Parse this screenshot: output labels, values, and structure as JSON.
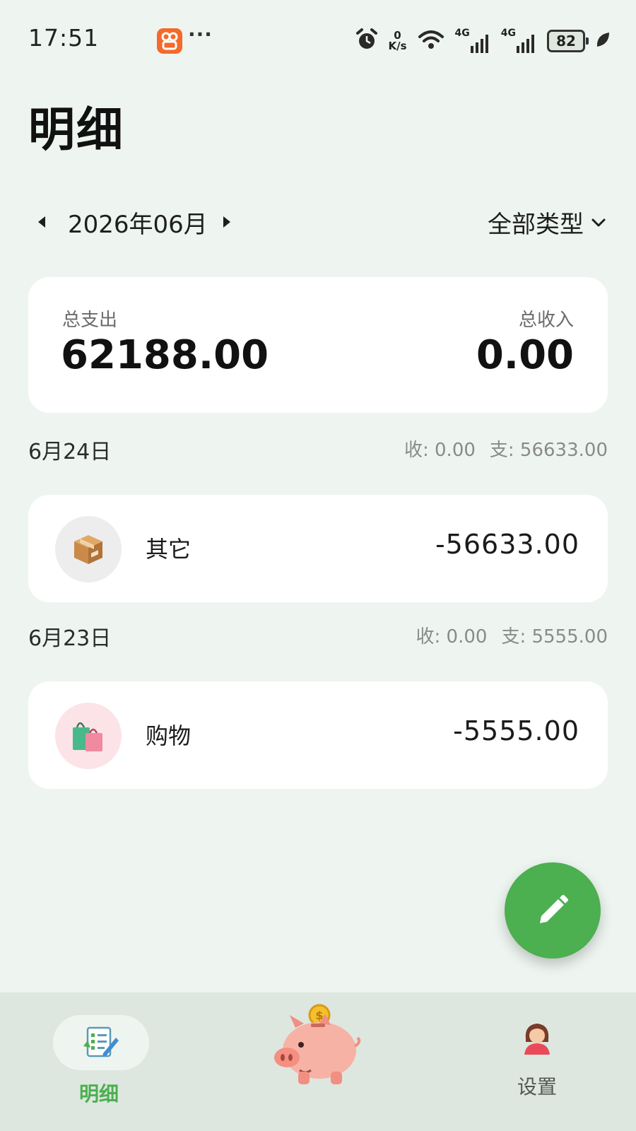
{
  "status_bar": {
    "time": "17:51",
    "dots": "···",
    "speed_value": "0",
    "speed_unit": "K/s",
    "net1": "4G",
    "net2": "4G",
    "battery": "82"
  },
  "header": {
    "title": "明细"
  },
  "filter": {
    "month": "2026年06月",
    "type": "全部类型"
  },
  "summary": {
    "expense_label": "总支出",
    "expense_value": "62188.00",
    "income_label": "总收入",
    "income_value": "0.00"
  },
  "days": [
    {
      "date": "6月24日",
      "income": "收: 0.00",
      "expense": "支: 56633.00",
      "items": [
        {
          "icon": "package-icon",
          "category": "其它",
          "amount": "-56633.00"
        }
      ]
    },
    {
      "date": "6月23日",
      "income": "收: 0.00",
      "expense": "支: 5555.00",
      "items": [
        {
          "icon": "shopping-bags-icon",
          "category": "购物",
          "amount": "-5555.00"
        }
      ]
    }
  ],
  "bottom_nav": {
    "detail_label": "明细",
    "settings_label": "设置"
  },
  "colors": {
    "background": "#eef5f0",
    "accent": "#4caf50",
    "nav_background": "#dde7df"
  }
}
